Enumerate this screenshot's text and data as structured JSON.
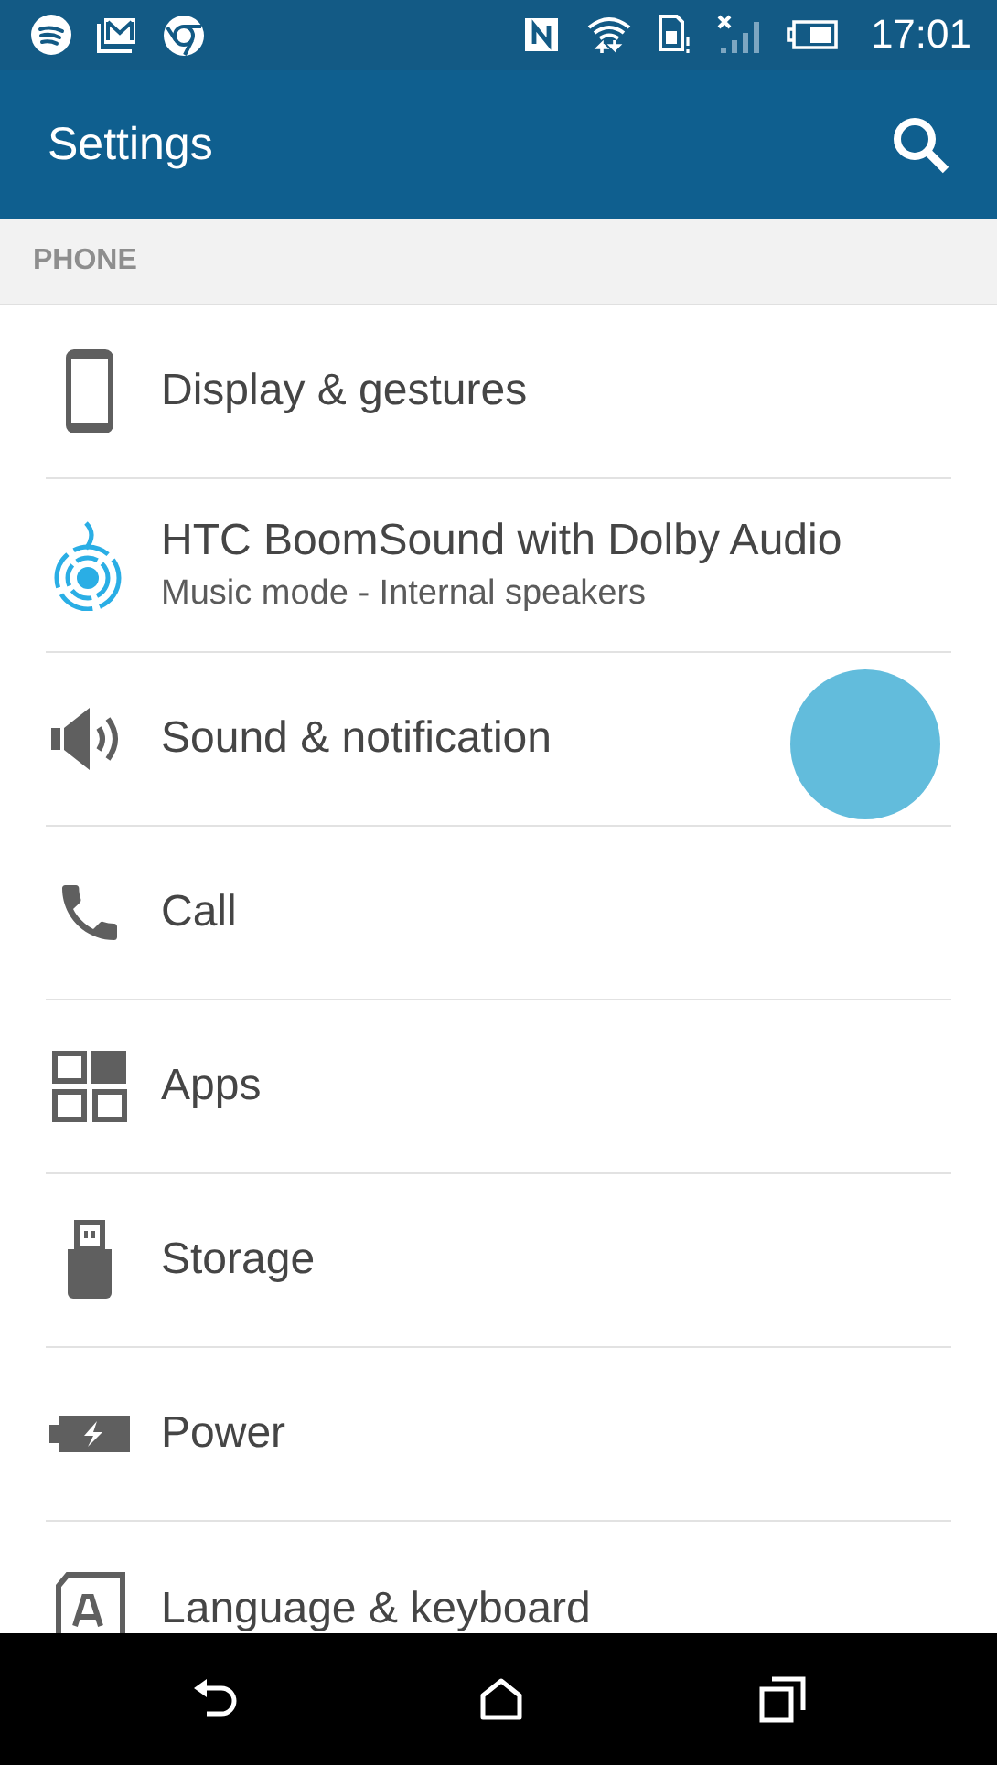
{
  "status_bar": {
    "time": "17:01"
  },
  "app_bar": {
    "title": "Settings"
  },
  "section": {
    "header": "PHONE"
  },
  "items": [
    {
      "title": "Display & gestures",
      "touched": false
    },
    {
      "title": "HTC BoomSound with Dolby Audio",
      "subtitle": "Music mode - Internal speakers",
      "touched": false
    },
    {
      "title": "Sound & notification",
      "touched": true
    },
    {
      "title": "Call",
      "touched": false
    },
    {
      "title": "Apps",
      "touched": false
    },
    {
      "title": "Storage",
      "touched": false
    },
    {
      "title": "Power",
      "touched": false
    },
    {
      "title": "Language & keyboard",
      "touched": false
    }
  ]
}
